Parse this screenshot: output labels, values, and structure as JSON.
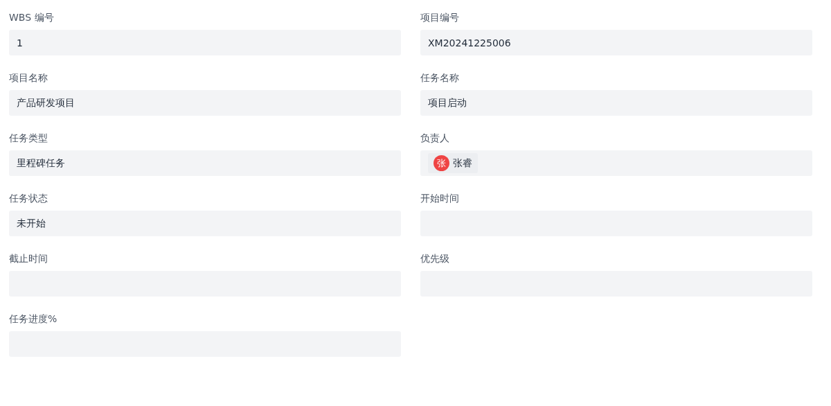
{
  "fields": [
    {
      "label": "WBS 编号",
      "kind": "text",
      "value": "1"
    },
    {
      "label": "项目编号",
      "kind": "text",
      "value": "XM20241225006"
    },
    {
      "label": "项目名称",
      "kind": "text",
      "value": "产品研发项目"
    },
    {
      "label": "任务名称",
      "kind": "text",
      "value": "项目启动"
    },
    {
      "label": "任务类型",
      "kind": "text",
      "value": "里程碑任务"
    },
    {
      "label": "负责人",
      "kind": "person",
      "avatar": "张",
      "value": "张睿"
    },
    {
      "label": "任务状态",
      "kind": "text",
      "value": "未开始"
    },
    {
      "label": "开始时间",
      "kind": "text"
    },
    {
      "label": "截止时间",
      "kind": "text"
    },
    {
      "label": "优先级",
      "kind": "text"
    },
    {
      "label": "任务进度%",
      "kind": "text"
    }
  ]
}
